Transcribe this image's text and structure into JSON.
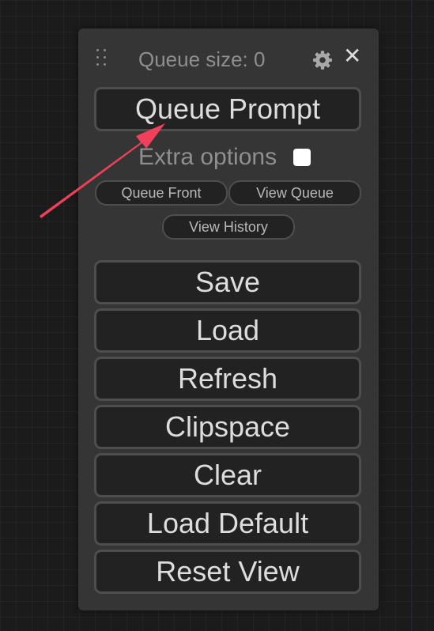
{
  "menu": {
    "queue_size_label": "Queue size: 0",
    "queue_prompt": "Queue Prompt",
    "extra_options": "Extra options",
    "extra_options_checked": false,
    "queue_front": "Queue Front",
    "view_queue": "View Queue",
    "view_history": "View History",
    "buttons": [
      "Save",
      "Load",
      "Refresh",
      "Clipspace",
      "Clear",
      "Load Default",
      "Reset View"
    ],
    "close_symbol": "✕",
    "icons": [
      "drag-handle-icon",
      "gear-icon",
      "close-icon",
      "pointer-arrow"
    ]
  },
  "colors": {
    "annotation_arrow": "#f0405a",
    "panel": "#353535",
    "button_bg": "#222222"
  }
}
